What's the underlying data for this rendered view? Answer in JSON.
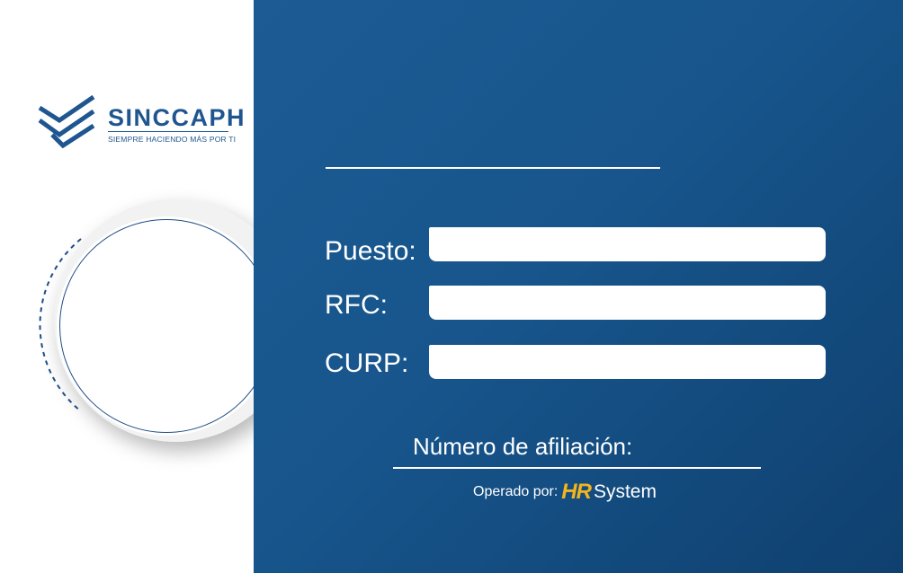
{
  "brand": {
    "name": "SINCCAPH",
    "tagline": "SIEMPRE HACIENDO MÁS POR TI"
  },
  "fields": [
    {
      "label": "Puesto:",
      "value": ""
    },
    {
      "label": "RFC:",
      "value": ""
    },
    {
      "label": "CURP:",
      "value": ""
    }
  ],
  "affiliation": {
    "label": "Número de afiliación:"
  },
  "footer": {
    "operated_by": "Operado por:",
    "hr_mark": "HR",
    "system": "System"
  },
  "colors": {
    "panel_blue": "#17558c",
    "brand_blue": "#1f5690",
    "hr_yellow": "#f2b51c",
    "white": "#ffffff"
  }
}
